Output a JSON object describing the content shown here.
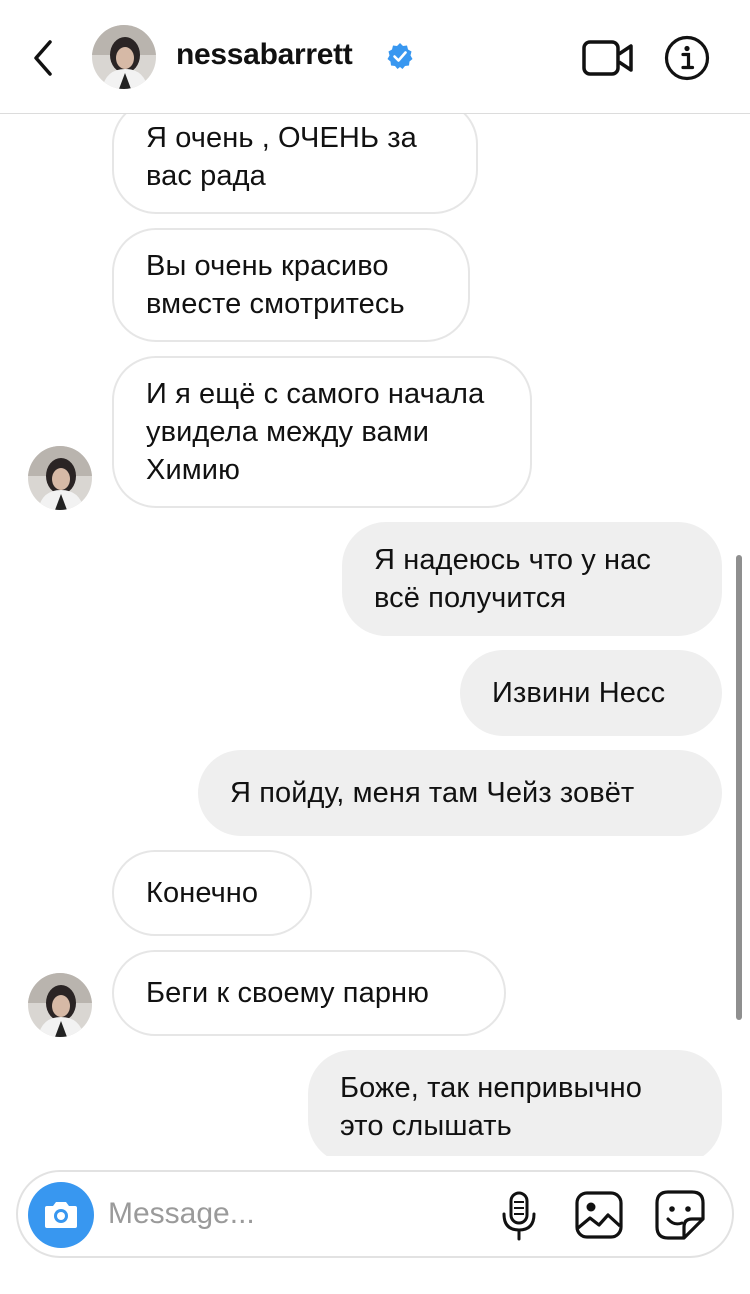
{
  "header": {
    "username": "nessabarrett",
    "verified": true,
    "icons": {
      "back": "chevron-left-icon",
      "video": "video-camera-icon",
      "info": "info-icon"
    }
  },
  "messages": [
    {
      "side": "received",
      "text": "Я очень , ОЧЕНЬ за вас рада"
    },
    {
      "side": "received",
      "text": "Вы очень красиво вместе смотритесь"
    },
    {
      "side": "received",
      "text": "И я ещё с самого начала увидела между вами Химию"
    },
    {
      "side": "sent",
      "text": "Я надеюсь что у нас всё получится"
    },
    {
      "side": "sent",
      "text": "Извини Несс"
    },
    {
      "side": "sent",
      "text": "Я пойду, меня там Чейз зовёт"
    },
    {
      "side": "received",
      "text": "Конечно"
    },
    {
      "side": "received",
      "text": "Беги к своему парню"
    },
    {
      "side": "sent",
      "text": "Боже, так непривычно это слышать"
    }
  ],
  "composer": {
    "placeholder": "Message...",
    "icons": [
      "camera-icon",
      "microphone-icon",
      "gallery-icon",
      "sticker-icon"
    ]
  },
  "colors": {
    "accent": "#3897f0",
    "sent_bubble": "#efefef",
    "received_border": "#e6e6e6"
  }
}
